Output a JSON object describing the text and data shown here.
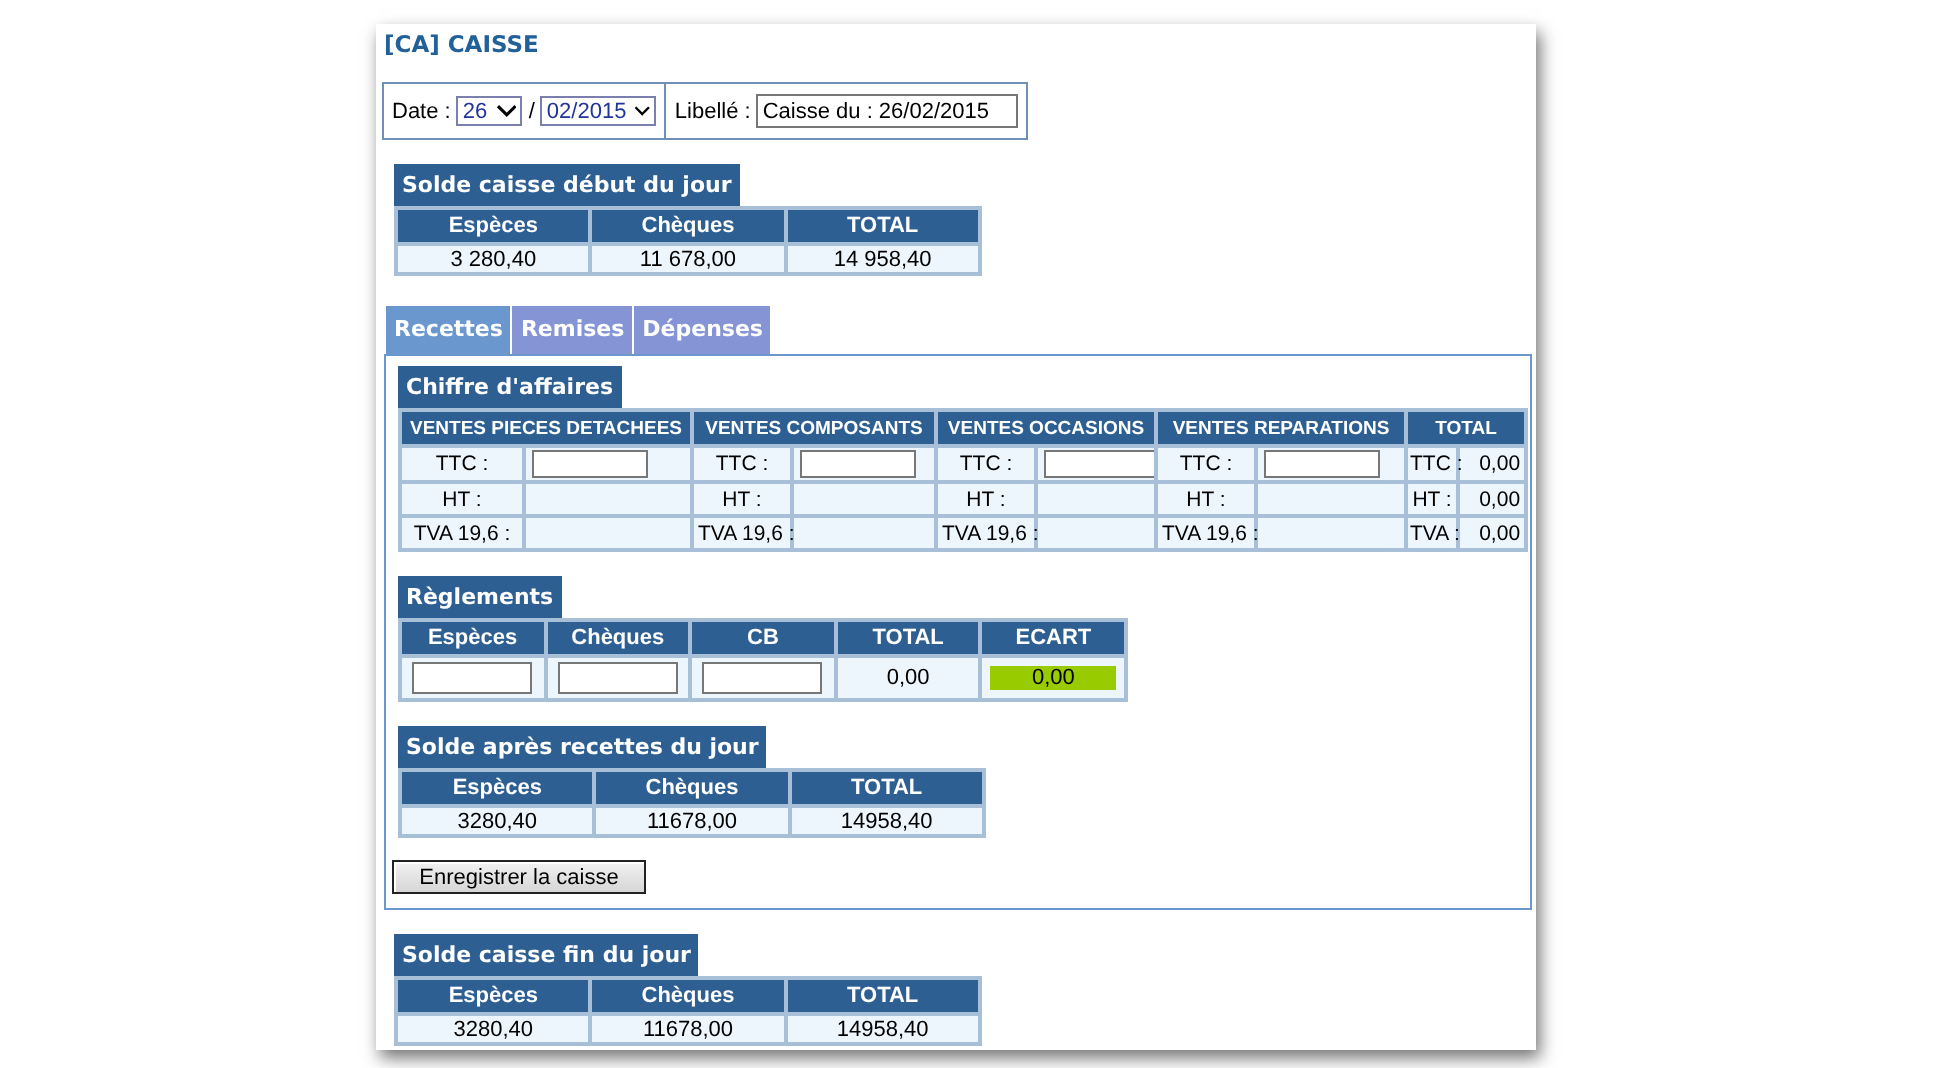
{
  "title": "[CA] CAISSE",
  "date": {
    "label": "Date :",
    "day": "26",
    "separator": "/",
    "month": "02/2015"
  },
  "libelle": {
    "label": "Libellé :",
    "value": "Caisse du : 26/02/2015"
  },
  "opening_balance": {
    "title": "Solde caisse début du jour",
    "columns": [
      "Espèces",
      "Chèques",
      "TOTAL"
    ],
    "values": [
      "3 280,40",
      "11 678,00",
      "14 958,40"
    ]
  },
  "tabs": [
    {
      "label": "Recettes",
      "selected": true
    },
    {
      "label": "Remises",
      "selected": false
    },
    {
      "label": "Dépenses",
      "selected": false
    }
  ],
  "revenue": {
    "title": "Chiffre d'affaires",
    "groups": [
      {
        "kind": "input",
        "heading": "VENTES PIECES DETACHEES",
        "labels": [
          "TTC :",
          "HT :",
          "TVA 19,6 :"
        ]
      },
      {
        "kind": "input",
        "heading": "VENTES COMPOSANTS",
        "labels": [
          "TTC :",
          "HT :",
          "TVA 19,6 :"
        ]
      },
      {
        "kind": "input",
        "heading": "VENTES OCCASIONS",
        "labels": [
          "TTC :",
          "HT :",
          "TVA 19,6 :"
        ]
      },
      {
        "kind": "input",
        "heading": "VENTES REPARATIONS",
        "labels": [
          "TTC :",
          "HT :",
          "TVA 19,6 :"
        ]
      },
      {
        "kind": "total",
        "heading": "TOTAL",
        "labels": [
          "TTC :",
          "HT :",
          "TVA :"
        ],
        "values": [
          "0,00",
          "0,00",
          "0,00"
        ]
      }
    ]
  },
  "payments": {
    "title": "Règlements",
    "columns": [
      {
        "kind": "input",
        "heading": "Espèces"
      },
      {
        "kind": "input",
        "heading": "Chèques"
      },
      {
        "kind": "input",
        "heading": "CB"
      },
      {
        "kind": "value",
        "heading": "TOTAL",
        "value": "0,00"
      },
      {
        "kind": "status",
        "heading": "ECART",
        "value": "0,00",
        "color": "#99cc00"
      }
    ]
  },
  "after_receipts": {
    "title": "Solde après recettes du jour",
    "columns": [
      "Espèces",
      "Chèques",
      "TOTAL"
    ],
    "values": [
      "3280,40",
      "11678,00",
      "14958,40"
    ]
  },
  "save_button": "Enregistrer la caisse",
  "closing_balance": {
    "title": "Solde caisse fin du jour",
    "columns": [
      "Espèces",
      "Chèques",
      "TOTAL"
    ],
    "values": [
      "3280,40",
      "11678,00",
      "14958,40"
    ]
  }
}
